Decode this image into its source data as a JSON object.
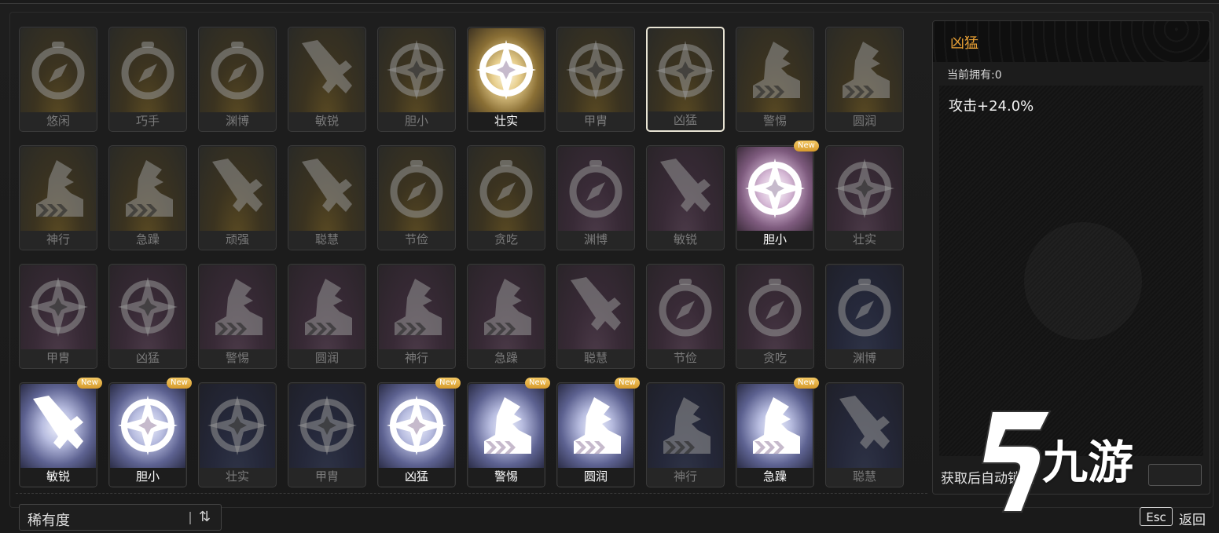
{
  "cards": [
    {
      "label": "悠闲",
      "icon": "compass-icon",
      "tier": "gold",
      "bright": false,
      "isNew": false
    },
    {
      "label": "巧手",
      "icon": "compass-icon",
      "tier": "gold",
      "bright": false,
      "isNew": false
    },
    {
      "label": "渊博",
      "icon": "compass-icon",
      "tier": "gold",
      "bright": false,
      "isNew": false
    },
    {
      "label": "敏锐",
      "icon": "sword-icon",
      "tier": "gold",
      "bright": false,
      "isNew": false
    },
    {
      "label": "胆小",
      "icon": "star-emblem-icon",
      "tier": "gold",
      "bright": false,
      "isNew": false
    },
    {
      "label": "壮实",
      "icon": "star-emblem-icon",
      "tier": "gold",
      "bright": true,
      "isNew": false
    },
    {
      "label": "甲胄",
      "icon": "star-emblem-icon",
      "tier": "gold",
      "bright": false,
      "isNew": false
    },
    {
      "label": "凶猛",
      "icon": "star-emblem-icon",
      "tier": "gold",
      "bright": false,
      "isNew": false,
      "selected": true
    },
    {
      "label": "警惕",
      "icon": "boot-icon",
      "tier": "gold",
      "bright": false,
      "isNew": false
    },
    {
      "label": "圆润",
      "icon": "boot-icon",
      "tier": "gold",
      "bright": false,
      "isNew": false
    },
    {
      "label": "神行",
      "icon": "boot-icon",
      "tier": "gold",
      "bright": false,
      "isNew": false
    },
    {
      "label": "急躁",
      "icon": "boot-icon",
      "tier": "gold",
      "bright": false,
      "isNew": false
    },
    {
      "label": "顽强",
      "icon": "sword-icon",
      "tier": "gold",
      "bright": false,
      "isNew": false
    },
    {
      "label": "聪慧",
      "icon": "sword-icon",
      "tier": "gold",
      "bright": false,
      "isNew": false
    },
    {
      "label": "节俭",
      "icon": "compass-icon",
      "tier": "gold",
      "bright": false,
      "isNew": false
    },
    {
      "label": "贪吃",
      "icon": "compass-icon",
      "tier": "gold",
      "bright": false,
      "isNew": false
    },
    {
      "label": "渊博",
      "icon": "compass-icon",
      "tier": "purple",
      "bright": false,
      "isNew": false
    },
    {
      "label": "敏锐",
      "icon": "sword-icon",
      "tier": "purple",
      "bright": false,
      "isNew": false
    },
    {
      "label": "胆小",
      "icon": "star-emblem-icon",
      "tier": "purple",
      "bright": true,
      "isNew": true
    },
    {
      "label": "壮实",
      "icon": "star-emblem-icon",
      "tier": "purple",
      "bright": false,
      "isNew": false
    },
    {
      "label": "甲胄",
      "icon": "star-emblem-icon",
      "tier": "purple",
      "bright": false,
      "isNew": false
    },
    {
      "label": "凶猛",
      "icon": "star-emblem-icon",
      "tier": "purple",
      "bright": false,
      "isNew": false
    },
    {
      "label": "警惕",
      "icon": "boot-icon",
      "tier": "purple",
      "bright": false,
      "isNew": false
    },
    {
      "label": "圆润",
      "icon": "boot-icon",
      "tier": "purple",
      "bright": false,
      "isNew": false
    },
    {
      "label": "神行",
      "icon": "boot-icon",
      "tier": "purple",
      "bright": false,
      "isNew": false
    },
    {
      "label": "急躁",
      "icon": "boot-icon",
      "tier": "purple",
      "bright": false,
      "isNew": false
    },
    {
      "label": "聪慧",
      "icon": "sword-icon",
      "tier": "purple",
      "bright": false,
      "isNew": false
    },
    {
      "label": "节俭",
      "icon": "compass-icon",
      "tier": "purple",
      "bright": false,
      "isNew": false
    },
    {
      "label": "贪吃",
      "icon": "compass-icon",
      "tier": "purple",
      "bright": false,
      "isNew": false
    },
    {
      "label": "渊博",
      "icon": "compass-icon",
      "tier": "blue",
      "bright": false,
      "isNew": false
    },
    {
      "label": "敏锐",
      "icon": "sword-icon",
      "tier": "blue",
      "bright": true,
      "isNew": true
    },
    {
      "label": "胆小",
      "icon": "star-emblem-icon",
      "tier": "blue",
      "bright": true,
      "isNew": true
    },
    {
      "label": "壮实",
      "icon": "star-emblem-icon",
      "tier": "blue",
      "bright": false,
      "isNew": false
    },
    {
      "label": "甲胄",
      "icon": "star-emblem-icon",
      "tier": "blue",
      "bright": false,
      "isNew": false
    },
    {
      "label": "凶猛",
      "icon": "star-emblem-icon",
      "tier": "blue",
      "bright": true,
      "isNew": true
    },
    {
      "label": "警惕",
      "icon": "boot-icon",
      "tier": "blue",
      "bright": true,
      "isNew": true
    },
    {
      "label": "圆润",
      "icon": "boot-icon",
      "tier": "blue",
      "bright": true,
      "isNew": true
    },
    {
      "label": "神行",
      "icon": "boot-icon",
      "tier": "blue",
      "bright": false,
      "isNew": false
    },
    {
      "label": "急躁",
      "icon": "boot-icon",
      "tier": "blue",
      "bright": true,
      "isNew": true
    },
    {
      "label": "聪慧",
      "icon": "sword-icon",
      "tier": "blue",
      "bright": false,
      "isNew": false
    }
  ],
  "newBadgeText": "New",
  "detail": {
    "title": "凶猛",
    "owned": "当前拥有:0",
    "effect": "攻击+24.0%",
    "autoLock": "获取后自动锁定"
  },
  "sort": {
    "label": "稀有度",
    "icon": "sort-arrows-icon",
    "glyph": "⇅"
  },
  "footer": {
    "escKey": "Esc",
    "back": "返回"
  },
  "watermark": {
    "text": "九游"
  },
  "colors": {
    "accent": "#e8a035",
    "newBadge": "#e8b448"
  }
}
